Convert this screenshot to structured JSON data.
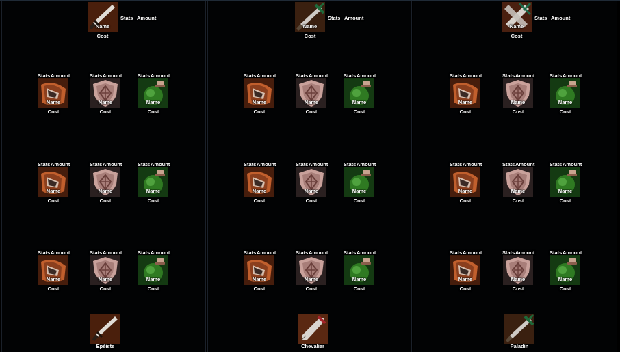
{
  "labels": {
    "name": "Name",
    "cost": "Cost",
    "stats": "Stats",
    "amount": "Amount"
  },
  "panels": [
    {
      "class_name": "Epéiste",
      "weapon_icon": "dagger-icon",
      "top_icon": "sword-red-icon"
    },
    {
      "class_name": "Chevalier",
      "weapon_icon": "broadsword-icon",
      "top_icon": "sword-green-icon"
    },
    {
      "class_name": "Paladin",
      "weapon_icon": "green-sword-icon",
      "top_icon": "crossed-swords-icon"
    }
  ],
  "item_icons": [
    "bracer-icon",
    "shield-icon",
    "potion-icon"
  ],
  "colors": {
    "panel_border": "#1a2029",
    "bracer": "#b85a2a",
    "shield": "#c49a95",
    "potion": "#3a8f2a"
  }
}
